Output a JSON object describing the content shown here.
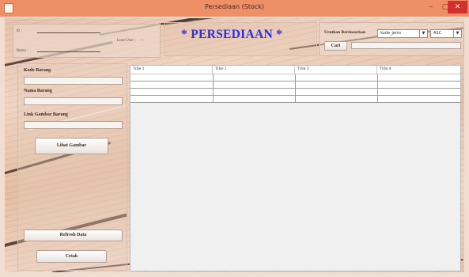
{
  "window": {
    "title": "Persediaan (Stock)",
    "controls": {
      "minimize": "–",
      "maximize": "▢",
      "close": "✕"
    }
  },
  "user_panel": {
    "id_label": "ID :",
    "name_label": "Nama :",
    "level_label": "Level User :",
    "level_value": "---"
  },
  "heading": "* PERSEDIAAN *",
  "sort_panel": {
    "label": "Urutkan Berdasarkan",
    "field_value": "kode_jenis",
    "order_value": "ASC",
    "search_button": "Cari",
    "search_value": ""
  },
  "form": {
    "kode_label": "Kode Barang",
    "nama_label": "Nama Barang",
    "link_label": "Link Gambar Barang",
    "lihat_button": "Lihat Gambar",
    "refresh_button": "Refresh Data",
    "cetak_button": "Cetak"
  },
  "table": {
    "columns": [
      "Title 1",
      "Title 2",
      "Title 3",
      "Title 4"
    ],
    "rows": [
      [
        "",
        "",
        "",
        ""
      ],
      [
        "",
        "",
        "",
        ""
      ],
      [
        "",
        "",
        "",
        ""
      ],
      [
        "",
        "",
        "",
        ""
      ]
    ]
  }
}
